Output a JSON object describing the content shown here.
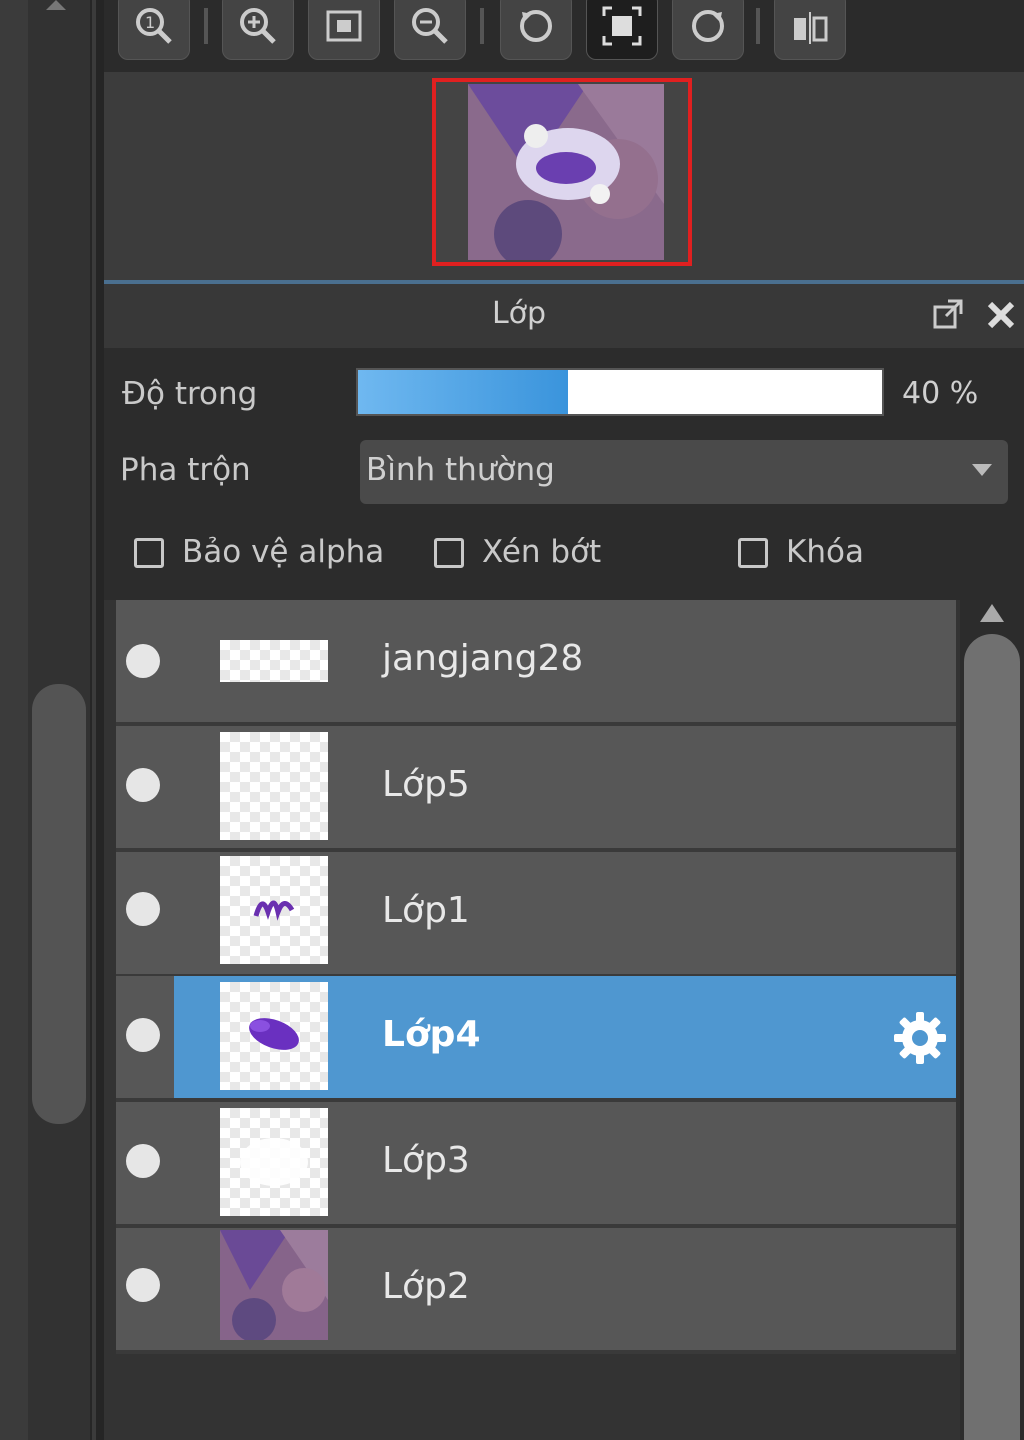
{
  "toolbar": {
    "buttons": [
      "zoom-actual-icon",
      "zoom-in-icon",
      "fit-screen-icon",
      "zoom-out-icon",
      "rotate-left-icon",
      "fullscreen-icon",
      "rotate-right-icon",
      "flip-icon"
    ]
  },
  "panel": {
    "title": "Lớp",
    "opacity_label": "Độ trong",
    "opacity_value": "40 %",
    "opacity_fraction": 0.4,
    "blend_label": "Pha trộn",
    "blend_value": "Bình thường",
    "checkboxes": [
      {
        "label": "Bảo vệ alpha",
        "checked": false
      },
      {
        "label": "Xén bớt",
        "checked": false
      },
      {
        "label": "Khóa",
        "checked": false
      }
    ]
  },
  "layers": [
    {
      "name": "jangjang28",
      "selected": false
    },
    {
      "name": "Lớp5",
      "selected": false
    },
    {
      "name": "Lớp1",
      "selected": false
    },
    {
      "name": "Lớp4",
      "selected": true
    },
    {
      "name": "Lớp3",
      "selected": false
    },
    {
      "name": "Lớp2",
      "selected": false
    }
  ],
  "colors": {
    "accent": "#4f97d0",
    "navigator_frame": "#e02020",
    "row_bg": "#575757"
  }
}
